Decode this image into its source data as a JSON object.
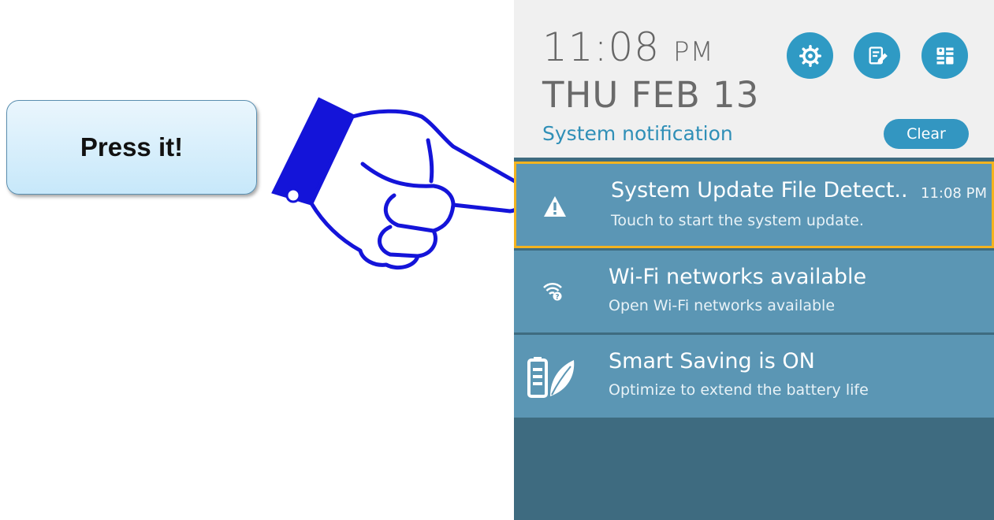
{
  "callout": {
    "label": "Press it!"
  },
  "status": {
    "time": "11:08",
    "ampm": "PM",
    "date": "THU FEB 13",
    "section_title": "System notification",
    "clear_label": "Clear"
  },
  "quick_actions": [
    {
      "icon": "gear-icon"
    },
    {
      "icon": "edit-note-icon"
    },
    {
      "icon": "contacts-grid-icon"
    }
  ],
  "notifications": [
    {
      "icon": "warning-icon",
      "title": "System Update File Detect..",
      "time": "11:08 PM",
      "subtitle": "Touch to start the system update."
    },
    {
      "icon": "wifi-question-icon",
      "title": "Wi-Fi networks available",
      "subtitle": "Open Wi-Fi networks available"
    },
    {
      "icon": "battery-leaf-icon",
      "title": "Smart Saving is ON",
      "subtitle": "Optimize to extend the battery life"
    }
  ],
  "colors": {
    "accent": "#2f9ac4",
    "notification_bg": "#5b96b4",
    "highlight_border": "#f3b31f",
    "panel_bg": "#3e6b80",
    "hand_stroke": "#1414d9"
  }
}
